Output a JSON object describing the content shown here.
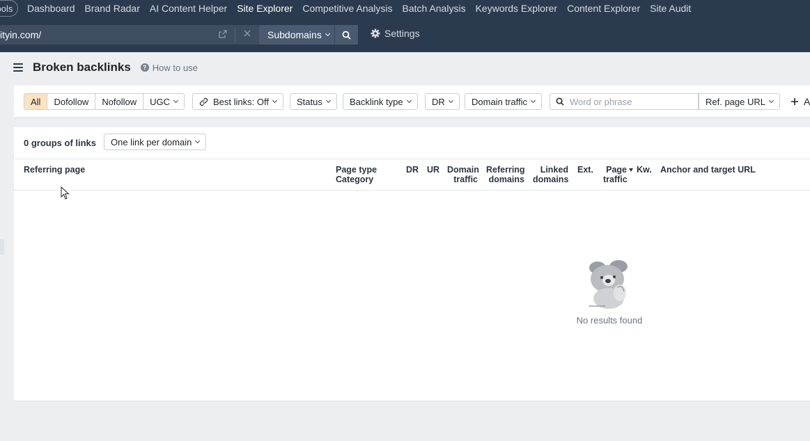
{
  "nav": {
    "tools_label": "Tools",
    "links": [
      "Dashboard",
      "Brand Radar",
      "AI Content Helper",
      "Site Explorer",
      "Competitive Analysis",
      "Batch Analysis",
      "Keywords Explorer",
      "Content Explorer",
      "Site Audit"
    ],
    "active": "Site Explorer"
  },
  "urlbar": {
    "url": "ityin.com/",
    "mode": "Subdomains",
    "settings_label": "Settings"
  },
  "page": {
    "title": "Broken backlinks",
    "how_to_use": "How to use"
  },
  "filters": {
    "link_types": [
      "All",
      "Dofollow",
      "Nofollow",
      "UGC"
    ],
    "best_links": "Best links: Off",
    "status": "Status",
    "backlink_type": "Backlink type",
    "dr": "DR",
    "domain_traffic": "Domain traffic",
    "search_placeholder": "Word or phrase",
    "ref_page_url": "Ref. page URL",
    "add_label": "A"
  },
  "results": {
    "groups_count": "0 groups of links",
    "grouping": "One link per domain",
    "columns": {
      "referring_page": "Referring page",
      "page_type_1": "Page type",
      "page_type_2": "Category",
      "dr": "DR",
      "ur": "UR",
      "domain_traffic_1": "Domain",
      "domain_traffic_2": "traffic",
      "ref_domains_1": "Referring",
      "ref_domains_2": "domains",
      "linked_domains_1": "Linked",
      "linked_domains_2": "domains",
      "ext": "Ext.",
      "page_traffic_1": "Page",
      "page_traffic_2": "traffic",
      "kw": "Kw.",
      "anchor": "Anchor and target URL"
    },
    "empty_message": "No results found"
  },
  "colors": {
    "nav_bg": "#2b3a4f",
    "active_segment": "#fde3c2"
  }
}
